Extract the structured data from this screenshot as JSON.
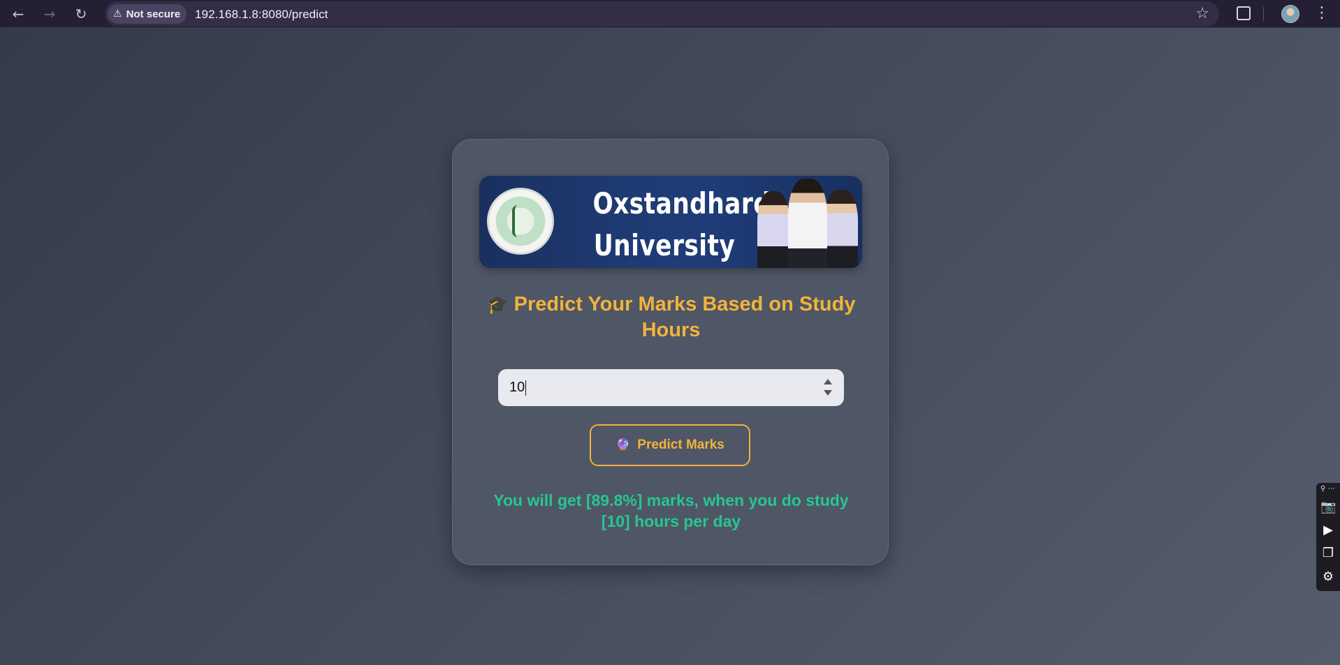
{
  "browser": {
    "back_icon": "arrow-left-icon",
    "forward_icon": "arrow-right-icon",
    "reload_icon": "reload-icon",
    "security_label": "Not secure",
    "url": "192.168.1.8:8080/predict",
    "bookmark_icon": "star-icon",
    "extensions_icon": "puzzle-icon",
    "menu_icon": "more-vertical-icon"
  },
  "banner": {
    "title_line1": "Oxstandhard",
    "title_line2": "University"
  },
  "form": {
    "heading": "Predict Your Marks Based on Study Hours",
    "heading_icon": "graduation-cap-icon",
    "hours_value": "10",
    "button_label": "Predict Marks",
    "button_icon": "crystal-ball-icon"
  },
  "result": {
    "text": "You will get [89.8%] marks, when you do study [10] hours per day"
  },
  "side_toolbar": {
    "icons": [
      "link-icon",
      "camera-icon",
      "video-icon",
      "windows-icon",
      "gear-icon"
    ]
  },
  "colors": {
    "accent": "#f2b33c",
    "result": "#27c690",
    "card": "#4f5665"
  }
}
